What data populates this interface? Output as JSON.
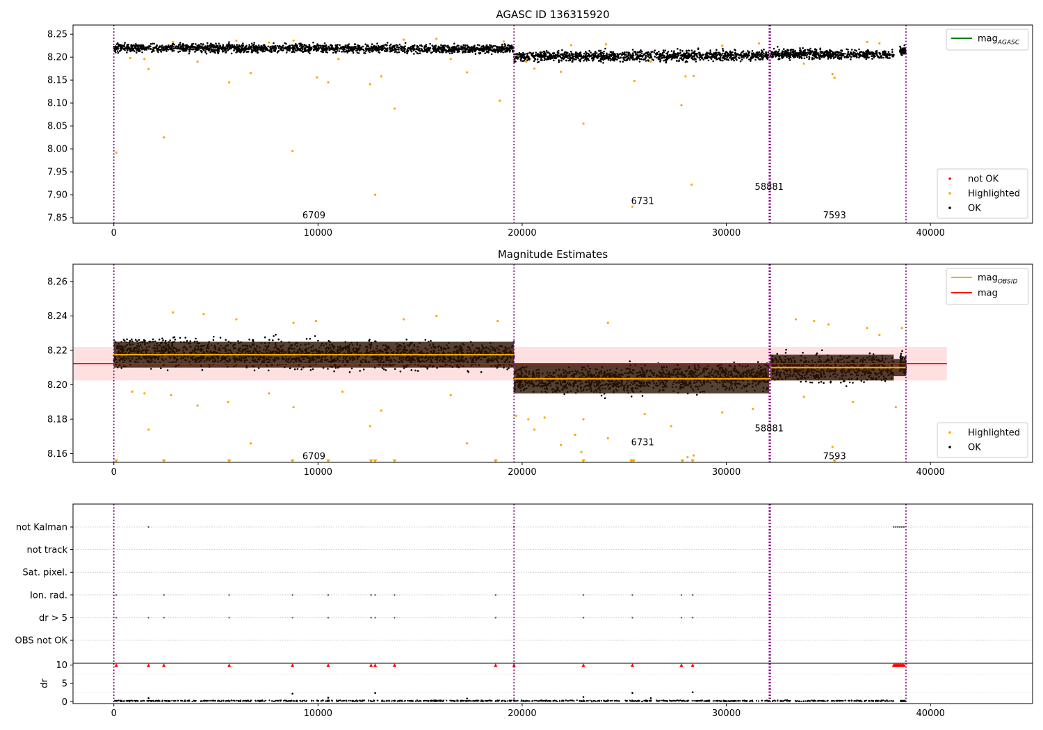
{
  "chart_data": [
    {
      "id": "top",
      "type": "scatter",
      "title": "AGASC ID 136315920",
      "xlim": [
        -2000,
        45000
      ],
      "ylim": [
        7.838,
        8.27
      ],
      "x_ticks": [
        0,
        10000,
        20000,
        30000,
        40000
      ],
      "x_tick_labels": [
        "0",
        "10000",
        "20000",
        "30000",
        "40000"
      ],
      "y_ticks": [
        7.85,
        7.9,
        7.95,
        8.0,
        8.05,
        8.1,
        8.15,
        8.2,
        8.25
      ],
      "y_tick_labels": [
        "7.85",
        "7.90",
        "7.95",
        "8.00",
        "8.05",
        "8.10",
        "8.15",
        "8.20",
        "8.25"
      ],
      "obs_boundaries": [
        0,
        19600,
        32100,
        32160,
        38800
      ],
      "obs_labels": [
        {
          "text": "6709",
          "x": 9800,
          "y": 7.855
        },
        {
          "text": "6731",
          "x": 25900,
          "y": 7.886
        },
        {
          "text": "58881",
          "x": 32100,
          "y": 7.917
        },
        {
          "text": "7593",
          "x": 35300,
          "y": 7.855
        }
      ],
      "ok_series": [
        {
          "x0": 0,
          "x1": 19600,
          "center_start": 8.22,
          "center_end": 8.218,
          "spread": 0.018
        },
        {
          "x0": 19600,
          "x1": 32100,
          "center_start": 8.201,
          "center_end": 8.204,
          "spread": 0.022
        },
        {
          "x0": 32160,
          "x1": 38200,
          "center_start": 8.208,
          "center_end": 8.205,
          "spread": 0.02
        },
        {
          "x0": 38500,
          "x1": 38800,
          "center_start": 8.212,
          "center_end": 8.212,
          "spread": 0.018
        }
      ],
      "highlighted": [
        [
          120,
          7.992
        ],
        [
          2450,
          8.025
        ],
        [
          8750,
          7.995
        ],
        [
          12800,
          7.9
        ],
        [
          13750,
          8.088
        ],
        [
          18900,
          8.105
        ],
        [
          23000,
          8.055
        ],
        [
          25400,
          7.874
        ],
        [
          27800,
          8.095
        ],
        [
          28300,
          7.922
        ],
        [
          1700,
          8.174
        ],
        [
          5650,
          8.145
        ],
        [
          10500,
          8.145
        ],
        [
          9950,
          8.156
        ],
        [
          12550,
          8.141
        ],
        [
          13100,
          8.158
        ],
        [
          17300,
          8.167
        ],
        [
          20600,
          8.175
        ],
        [
          21900,
          8.168
        ],
        [
          25500,
          8.148
        ],
        [
          28000,
          8.158
        ],
        [
          28400,
          8.159
        ],
        [
          35200,
          8.163
        ],
        [
          35300,
          8.155
        ],
        [
          6700,
          8.165
        ],
        [
          800,
          8.198
        ],
        [
          1500,
          8.196
        ],
        [
          2900,
          8.233
        ],
        [
          4100,
          8.19
        ],
        [
          6000,
          8.236
        ],
        [
          7600,
          8.232
        ],
        [
          8800,
          8.236
        ],
        [
          11000,
          8.196
        ],
        [
          14200,
          8.238
        ],
        [
          15800,
          8.24
        ],
        [
          16500,
          8.196
        ],
        [
          19100,
          8.234
        ],
        [
          20200,
          8.19
        ],
        [
          22400,
          8.226
        ],
        [
          24100,
          8.228
        ],
        [
          26300,
          8.19
        ],
        [
          29800,
          8.225
        ],
        [
          31600,
          8.23
        ],
        [
          33800,
          8.186
        ],
        [
          36900,
          8.233
        ],
        [
          37500,
          8.23
        ]
      ],
      "legend_upper": [
        {
          "label": "mag",
          "subscript": "AGASC",
          "color": "#008000"
        }
      ],
      "legend_lower": [
        {
          "label": "not OK",
          "color": "#ff0000"
        },
        {
          "label": "Highlighted",
          "color": "#ffa500"
        },
        {
          "label": "OK",
          "color": "#000000"
        }
      ],
      "colors": {
        "ok": "#000000",
        "highlighted": "#ffa500",
        "boundary": "#800080"
      }
    },
    {
      "id": "middle",
      "type": "scatter",
      "title": "Magnitude Estimates",
      "xlim": [
        -2000,
        45000
      ],
      "ylim": [
        8.155,
        8.27
      ],
      "x_ticks": [
        0,
        10000,
        20000,
        30000,
        40000
      ],
      "x_tick_labels": [
        "0",
        "10000",
        "20000",
        "30000",
        "40000"
      ],
      "y_ticks": [
        8.16,
        8.18,
        8.2,
        8.22,
        8.24,
        8.26
      ],
      "y_tick_labels": [
        "8.16",
        "8.18",
        "8.20",
        "8.22",
        "8.24",
        "8.26"
      ],
      "obs_boundaries": [
        0,
        19600,
        32100,
        32160,
        38800
      ],
      "obs_labels": [
        {
          "text": "6709",
          "x": 9800,
          "y": 8.1585
        },
        {
          "text": "6731",
          "x": 25900,
          "y": 8.1665
        },
        {
          "text": "58881",
          "x": 32100,
          "y": 8.1745
        },
        {
          "text": "7593",
          "x": 35300,
          "y": 8.1585
        }
      ],
      "mag": {
        "value": 8.2123,
        "band": [
          8.2025,
          8.222
        ],
        "x0": -2000,
        "x1": 40800,
        "color": "#ff0000"
      },
      "mag_obsid": [
        {
          "x0": 0,
          "x1": 19600,
          "value": 8.2175,
          "band": [
            8.21,
            8.225
          ]
        },
        {
          "x0": 19600,
          "x1": 32100,
          "value": 8.2035,
          "band": [
            8.195,
            8.212
          ]
        },
        {
          "x0": 32160,
          "x1": 38200,
          "value": 8.21,
          "band": [
            8.2025,
            8.2175
          ]
        },
        {
          "x0": 38200,
          "x1": 38800,
          "value": 8.21,
          "band": [
            8.205,
            8.215
          ]
        }
      ],
      "ok_series": [
        {
          "x0": 0,
          "x1": 19600,
          "center_start": 8.219,
          "center_end": 8.2165,
          "spread": 0.0155
        },
        {
          "x0": 19600,
          "x1": 32100,
          "center_start": 8.202,
          "center_end": 8.205,
          "spread": 0.015
        },
        {
          "x0": 32160,
          "x1": 38200,
          "center_start": 8.2105,
          "center_end": 8.209,
          "spread": 0.015
        },
        {
          "x0": 38500,
          "x1": 38800,
          "center_start": 8.212,
          "center_end": 8.212,
          "spread": 0.014
        }
      ],
      "highlighted": [
        [
          1700,
          8.174
        ],
        [
          6700,
          8.166
        ],
        [
          12550,
          8.176
        ],
        [
          17300,
          8.166
        ],
        [
          20600,
          8.174
        ],
        [
          20300,
          8.18
        ],
        [
          21100,
          8.181
        ],
        [
          21900,
          8.165
        ],
        [
          22600,
          8.171
        ],
        [
          24200,
          8.169
        ],
        [
          27300,
          8.176
        ],
        [
          28100,
          8.158
        ],
        [
          28400,
          8.159
        ],
        [
          22900,
          8.161
        ],
        [
          35200,
          8.164
        ],
        [
          13100,
          8.185
        ],
        [
          8800,
          8.187
        ],
        [
          4100,
          8.188
        ],
        [
          5600,
          8.19
        ],
        [
          2900,
          8.242
        ],
        [
          4400,
          8.241
        ],
        [
          6000,
          8.238
        ],
        [
          8800,
          8.236
        ],
        [
          9900,
          8.237
        ],
        [
          14200,
          8.238
        ],
        [
          15800,
          8.24
        ],
        [
          18800,
          8.237
        ],
        [
          24200,
          8.236
        ],
        [
          33400,
          8.238
        ],
        [
          34300,
          8.237
        ],
        [
          35000,
          8.235
        ],
        [
          36900,
          8.233
        ],
        [
          37500,
          8.229
        ],
        [
          38600,
          8.233
        ],
        [
          900,
          8.196
        ],
        [
          1500,
          8.195
        ],
        [
          2800,
          8.194
        ],
        [
          7600,
          8.195
        ],
        [
          11200,
          8.196
        ],
        [
          16500,
          8.194
        ],
        [
          19700,
          8.182
        ],
        [
          23000,
          8.18
        ],
        [
          26000,
          8.183
        ],
        [
          29800,
          8.184
        ],
        [
          31300,
          8.186
        ],
        [
          33800,
          8.193
        ],
        [
          36200,
          8.19
        ],
        [
          38300,
          8.187
        ]
      ],
      "lower_limits_x": [
        120,
        2450,
        5650,
        8750,
        10500,
        12600,
        12800,
        13750,
        18700,
        23000,
        25350,
        25450,
        27850,
        28350,
        35300
      ],
      "lower_limit_y": 8.1555,
      "legend_upper": [
        {
          "label": "mag",
          "subscript": "OBSID",
          "color": "#ffa500"
        },
        {
          "label": "mag",
          "subscript": "",
          "color": "#ff0000"
        }
      ],
      "legend_lower": [
        {
          "label": "Highlighted",
          "color": "#ffa500"
        },
        {
          "label": "OK",
          "color": "#000000"
        }
      ],
      "colors": {
        "ok": "#000000",
        "highlighted": "#ffa500",
        "boundary": "#800080",
        "band_fill": "#ffcccc",
        "obsid_band": "#2b1300"
      }
    },
    {
      "id": "flags",
      "type": "scatter",
      "categories": [
        "not Kalman",
        "not track",
        "Sat. pixel.",
        "Ion. rad.",
        "dr > 5",
        "OBS not OK"
      ],
      "xlim": [
        -2000,
        45000
      ],
      "obs_boundaries": [
        0,
        19600,
        32100,
        32160,
        38800
      ],
      "points": {
        "not Kalman": [
          1700,
          19600,
          38200,
          38300,
          38400,
          38500,
          38600,
          38700
        ],
        "not track": [],
        "Sat. pixel.": [],
        "Ion. rad.": [
          120,
          2450,
          5650,
          8750,
          10500,
          12600,
          12800,
          13750,
          18700,
          23000,
          25400,
          27800,
          28350
        ],
        "dr > 5": [
          120,
          1700,
          2450,
          5650,
          8750,
          10500,
          12600,
          12800,
          13750,
          18700,
          23000,
          25400,
          27800,
          28350
        ],
        "OBS not OK": []
      },
      "colors": {
        "points": "#555555",
        "grid": "#bbbbbb",
        "boundary": "#800080"
      }
    },
    {
      "id": "dr",
      "type": "scatter",
      "ylabel": "dr",
      "xlim": [
        -2000,
        45000
      ],
      "ylim": [
        -0.5,
        10.5
      ],
      "x_ticks": [
        0,
        10000,
        20000,
        30000,
        40000
      ],
      "x_tick_labels": [
        "0",
        "10000",
        "20000",
        "30000",
        "40000"
      ],
      "y_ticks": [
        0,
        5,
        10
      ],
      "y_tick_labels": [
        "0",
        "5",
        "10"
      ],
      "obs_boundaries": [
        0,
        19600,
        32100,
        32160,
        38800
      ],
      "base_series": [
        {
          "x0": 0,
          "x1": 38200,
          "center": 0.25,
          "spread": 0.3
        },
        {
          "x0": 38500,
          "x1": 38800,
          "center": 0.25,
          "spread": 0.3
        }
      ],
      "outliers": [
        [
          8750,
          2.2
        ],
        [
          12800,
          2.4
        ],
        [
          25400,
          2.4
        ],
        [
          28350,
          2.6
        ],
        [
          23000,
          1.3
        ],
        [
          10500,
          1.1
        ],
        [
          17300,
          0.9
        ],
        [
          26300,
          1.0
        ],
        [
          1700,
          1.0
        ]
      ],
      "clipped_x": [
        120,
        1700,
        2450,
        5650,
        8750,
        10500,
        12600,
        12800,
        13750,
        18700,
        19600,
        23000,
        25400,
        27800,
        28350,
        38200,
        38250,
        38300,
        38350,
        38400,
        38450,
        38500,
        38550,
        38600,
        38650,
        38700
      ],
      "clipped_y": 10,
      "colors": {
        "points": "#000000",
        "clipped": "#ff0000",
        "boundary": "#800080"
      }
    }
  ]
}
